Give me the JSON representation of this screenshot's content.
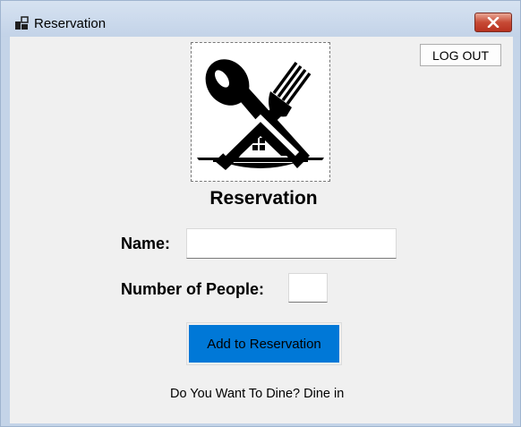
{
  "window": {
    "title": "Reservation",
    "app_icon": "app-window-icon",
    "close_icon": "close-icon"
  },
  "toolbar": {
    "logout_label": "LOG OUT"
  },
  "logo": {
    "icon": "restaurant-spoon-fork-house-logo"
  },
  "form": {
    "heading": "Reservation",
    "name_label": "Name:",
    "name_value": "",
    "people_label": "Number of People:",
    "people_value": "",
    "submit_label": "Add to Reservation"
  },
  "footer": {
    "dine_text": "Do You Want To Dine? Dine in"
  },
  "colors": {
    "accent": "#0078d7",
    "close_button": "#c74a35",
    "client_background": "#f0f0f0",
    "titlebar": "#c4d4e8"
  }
}
